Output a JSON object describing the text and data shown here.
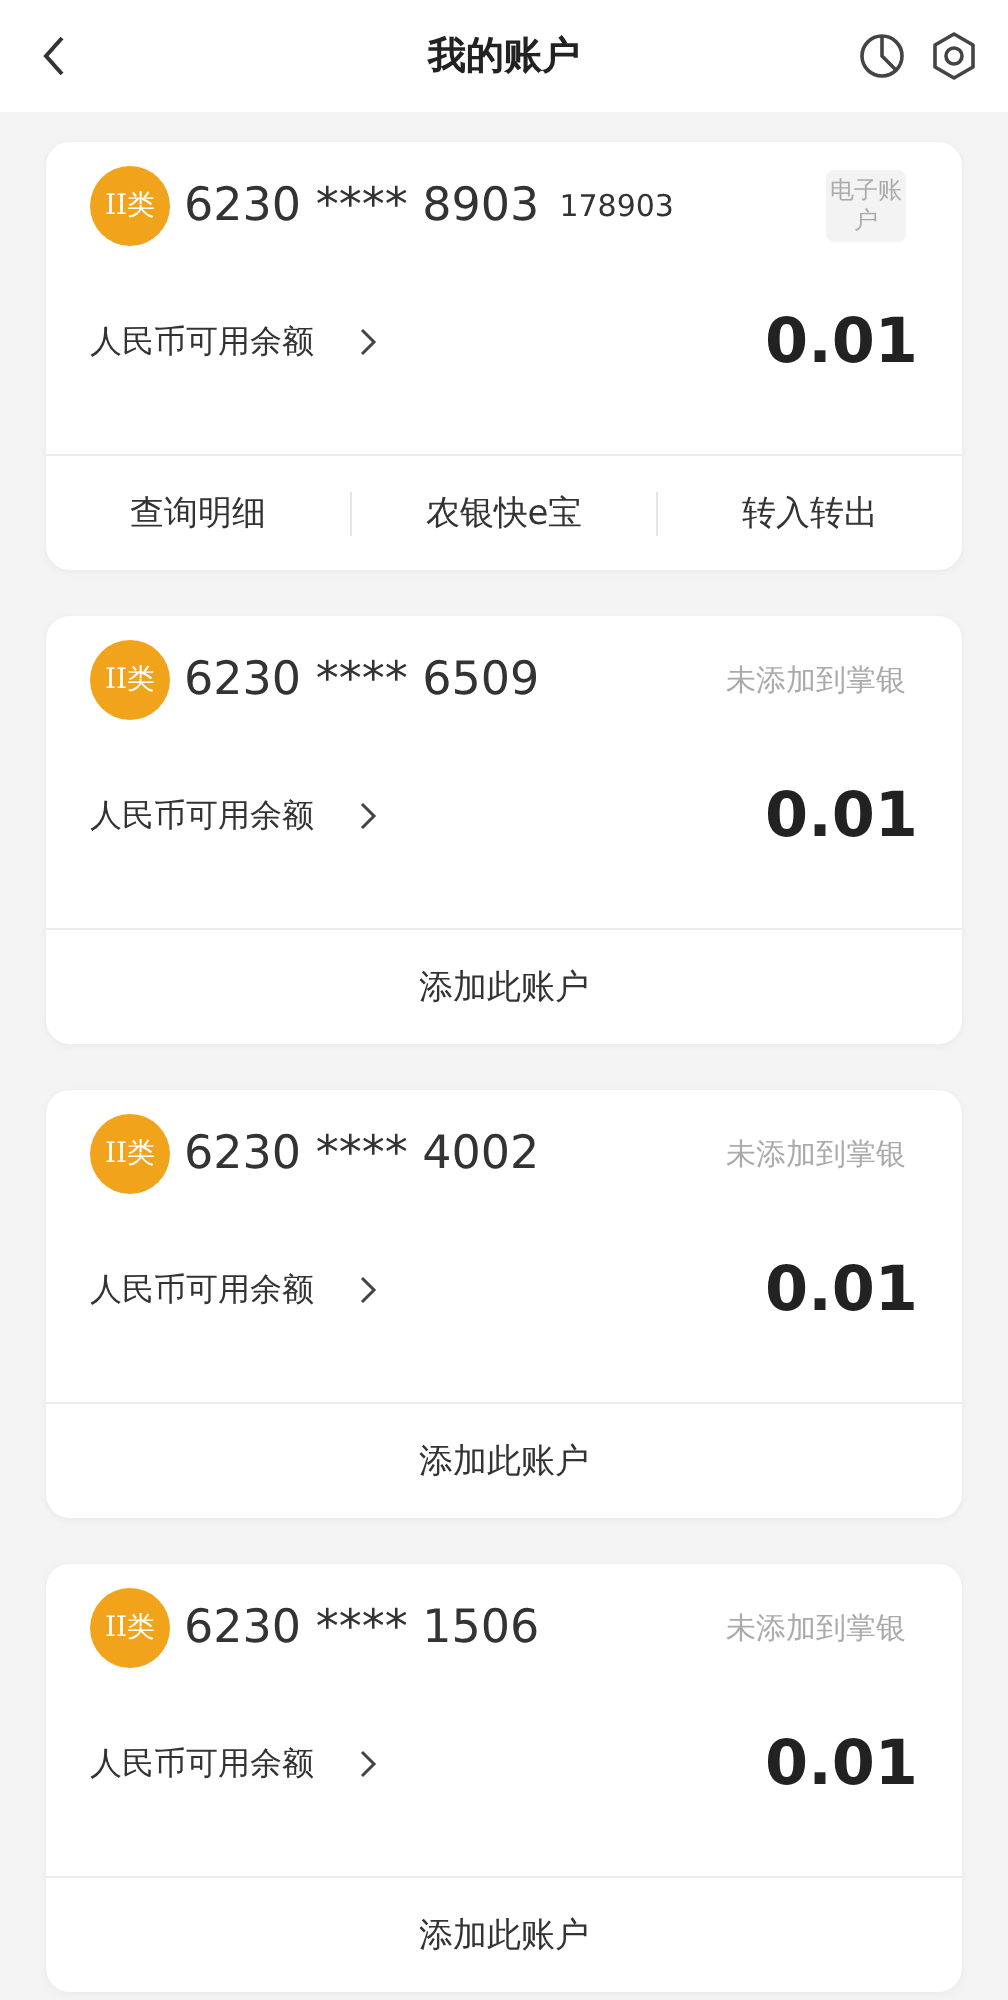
{
  "header": {
    "title": "我的账户"
  },
  "accounts": [
    {
      "kind": "tag",
      "badge": "II类",
      "number": "6230 **** 8903",
      "extra": "178903",
      "tag": "电子账户",
      "balance_label": "人民币可用余额",
      "balance": "0.01",
      "actions": [
        "查询明细",
        "农银快e宝",
        "转入转出"
      ]
    },
    {
      "kind": "status",
      "badge": "II类",
      "number": "6230 **** 6509",
      "status": "未添加到掌银",
      "balance_label": "人民币可用余额",
      "balance": "0.01",
      "actions": [
        "添加此账户"
      ]
    },
    {
      "kind": "status",
      "badge": "II类",
      "number": "6230 **** 4002",
      "status": "未添加到掌银",
      "balance_label": "人民币可用余额",
      "balance": "0.01",
      "actions": [
        "添加此账户"
      ]
    },
    {
      "kind": "status",
      "badge": "II类",
      "number": "6230 **** 1506",
      "status": "未添加到掌银",
      "balance_label": "人民币可用余额",
      "balance": "0.01",
      "actions": [
        "添加此账户"
      ]
    }
  ]
}
